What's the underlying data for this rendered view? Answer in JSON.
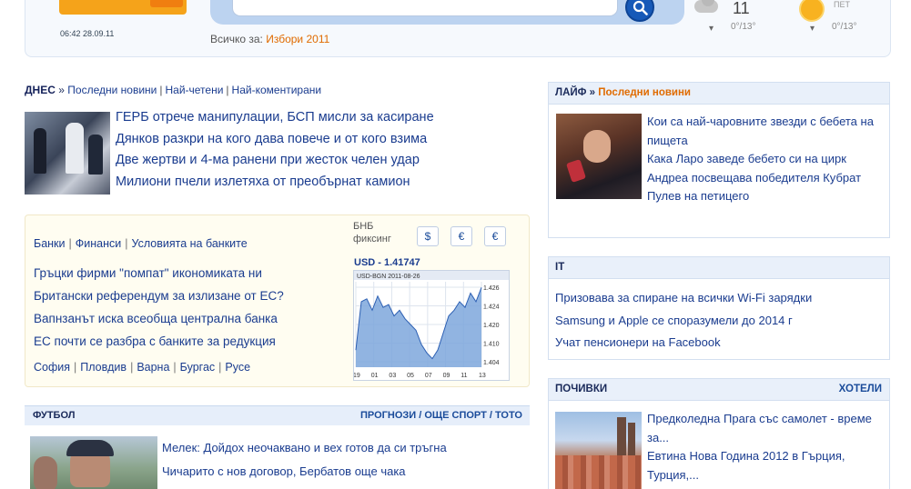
{
  "header": {
    "datetime": "06:42 28.09.11",
    "search": {
      "placeholder": ""
    },
    "all_for_label": "Всичко за:",
    "all_for_link": "Избори 2011",
    "weather": [
      {
        "icon": "cloud-icon",
        "small": "",
        "temp": "11",
        "range": "0°/13°"
      },
      {
        "icon": "sun-icon",
        "small": "ПЕТ",
        "temp": "",
        "range": "0°/13°"
      }
    ]
  },
  "today": {
    "label": "ДНЕС",
    "tabs": [
      "Последни новини",
      "Най-четени",
      "Най-коментирани"
    ],
    "news": [
      "ГЕРБ отрече манипулации, БСП мисли за касиране",
      "Дянков разкри на кого дава повече и от кого взима",
      "Две жертви и 4-ма ранени при жесток челен удар",
      "Милиони пчели излетяха от преобърнат камион"
    ]
  },
  "finance": {
    "links": [
      "Банки",
      "Финанси",
      "Условията на банките"
    ],
    "news": [
      "Гръцки фирми \"помпат\" икономиката ни",
      "Британски референдум за излизане от ЕС?",
      "Вапнзанът иска всеобща централна банка",
      "ЕС почти се разбра с банките за редукция"
    ],
    "cities": [
      "София",
      "Пловдив",
      "Варна",
      "Бургас",
      "Русе"
    ],
    "bnb_label": "БНБ фиксинг",
    "currency_buttons": [
      "$",
      "€",
      "€"
    ],
    "rate": "USD - 1.41747",
    "chart_header": "USD-BGN 2011-08-26",
    "x_ticks": [
      "19",
      "01",
      "03",
      "05",
      "07",
      "09",
      "11",
      "13"
    ],
    "y_ticks": [
      "1.426",
      "1.424",
      "1.420",
      "1.410",
      "1.404"
    ]
  },
  "football": {
    "title": "ФУТБОЛ",
    "right_links": "ПРОГНОЗИ / ОЩЕ СПОРТ / ТОТО",
    "news": [
      "Мелек: Дойдох неочаквано и вех готов да си тръгна",
      "Чичарито с нов договор, Бербатов още чака"
    ]
  },
  "life": {
    "title": "ЛАЙФ",
    "subtitle": "Последни новини",
    "news": [
      "Кои са най-чаровните звезди с бебета на пищета",
      "Кака Ларо заведе бебето си на цирк",
      "Андреа посвещава победителя Кубрат Пулев на петицего"
    ]
  },
  "it": {
    "title": "IT",
    "news": [
      "Призовава за спиране на всички Wi-Fi зарядки",
      "Samsung и Apple се споразумели до 2014 г",
      "Учат пенсионери на Facebook"
    ]
  },
  "travel": {
    "title": "ПОЧИВКИ",
    "right_link": "ХОТЕЛИ",
    "news": [
      "Предколедна Прага със самолет - време за...",
      "Евтина Нова Година 2012 в Гърция, Турция,..."
    ]
  },
  "colors": {
    "link": "#1a3c8f",
    "accent_orange": "#e06b00",
    "header_bg": "#f6f9fd",
    "box_header_bg": "#e9f0fa",
    "finance_bg": "#fffdf1",
    "chart_fill": "#7ea7dc"
  },
  "chart_data": {
    "type": "area",
    "title": "USD-BGN 2011-08-26",
    "x": [
      "19",
      "01",
      "03",
      "05",
      "07",
      "09",
      "11",
      "13"
    ],
    "series": [
      {
        "name": "USD",
        "values": [
          1.404,
          1.421,
          1.422,
          1.418,
          1.423,
          1.419,
          1.42,
          1.416,
          1.418,
          1.415,
          1.413,
          1.411,
          1.406,
          1.403,
          1.401,
          1.404,
          1.41,
          1.416,
          1.418,
          1.421,
          1.419,
          1.424,
          1.421,
          1.426
        ]
      }
    ],
    "ylim": [
      1.398,
      1.428
    ],
    "grid": true
  }
}
